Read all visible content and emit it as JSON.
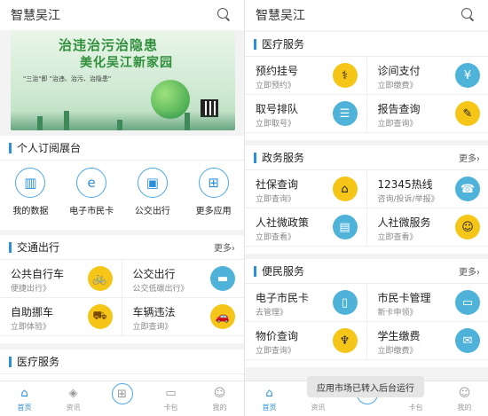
{
  "left": {
    "app_title": "智慧吴江",
    "banner": {
      "line1": "治违治污治隐患",
      "line2": "美化吴江新家园",
      "line3": "\"三治\"即 \"治违、治污、治隐患\""
    },
    "subscription": {
      "title": "个人订阅展台",
      "items": [
        {
          "label": "我的数据",
          "icon": "data-icon"
        },
        {
          "label": "电子市民卡",
          "icon": "ecard-icon"
        },
        {
          "label": "公交出行",
          "icon": "bus-icon"
        },
        {
          "label": "更多应用",
          "icon": "apps-icon"
        }
      ]
    },
    "traffic": {
      "title": "交通出行",
      "more": "更多›",
      "items": [
        {
          "title": "公共自行车",
          "sub": "便捷出行》",
          "icon": "bike-icon"
        },
        {
          "title": "公交出行",
          "sub": "公交低碳出行》",
          "icon": "bus-icon"
        },
        {
          "title": "自助挪车",
          "sub": "立即体验》",
          "icon": "tow-truck-icon"
        },
        {
          "title": "车辆违法",
          "sub": "立即查询》",
          "icon": "car-icon"
        }
      ]
    },
    "medical_partial": {
      "title": "医疗服务"
    }
  },
  "right": {
    "app_title": "智慧吴江",
    "medical": {
      "title": "医疗服务",
      "items": [
        {
          "title": "预约挂号",
          "sub": "立即预约》",
          "icon": "doctor-icon"
        },
        {
          "title": "诊间支付",
          "sub": "立即缴费》",
          "icon": "payment-icon"
        },
        {
          "title": "取号排队",
          "sub": "立即取号》",
          "icon": "queue-icon"
        },
        {
          "title": "报告查询",
          "sub": "立即查询》",
          "icon": "report-icon"
        }
      ]
    },
    "gov": {
      "title": "政务服务",
      "more": "更多›",
      "items": [
        {
          "title": "社保查询",
          "sub": "立即查询》",
          "icon": "social-security-icon"
        },
        {
          "title": "12345热线",
          "sub": "咨询/投诉/举报》",
          "icon": "hotline-icon"
        },
        {
          "title": "人社微政策",
          "sub": "立即查看》",
          "icon": "policy-icon"
        },
        {
          "title": "人社微服务",
          "sub": "立即查看》",
          "icon": "service-icon"
        }
      ]
    },
    "civic": {
      "title": "便民服务",
      "more": "更多›",
      "items": [
        {
          "title": "电子市民卡",
          "sub": "去管理》",
          "icon": "phone-card-icon"
        },
        {
          "title": "市民卡管理",
          "sub": "新卡申领》",
          "icon": "card-manage-icon"
        },
        {
          "title": "物价查询",
          "sub": "立即查询》",
          "icon": "price-icon"
        },
        {
          "title": "学生缴费",
          "sub": "立即缴费》",
          "icon": "student-pay-icon"
        }
      ]
    },
    "toast": "应用市场已转入后台运行"
  },
  "tabbar": [
    "首页",
    "资讯",
    "",
    "卡包",
    "我的"
  ],
  "colors": {
    "accent": "#2d8fd9",
    "banner_text": "#2f8f3b"
  }
}
